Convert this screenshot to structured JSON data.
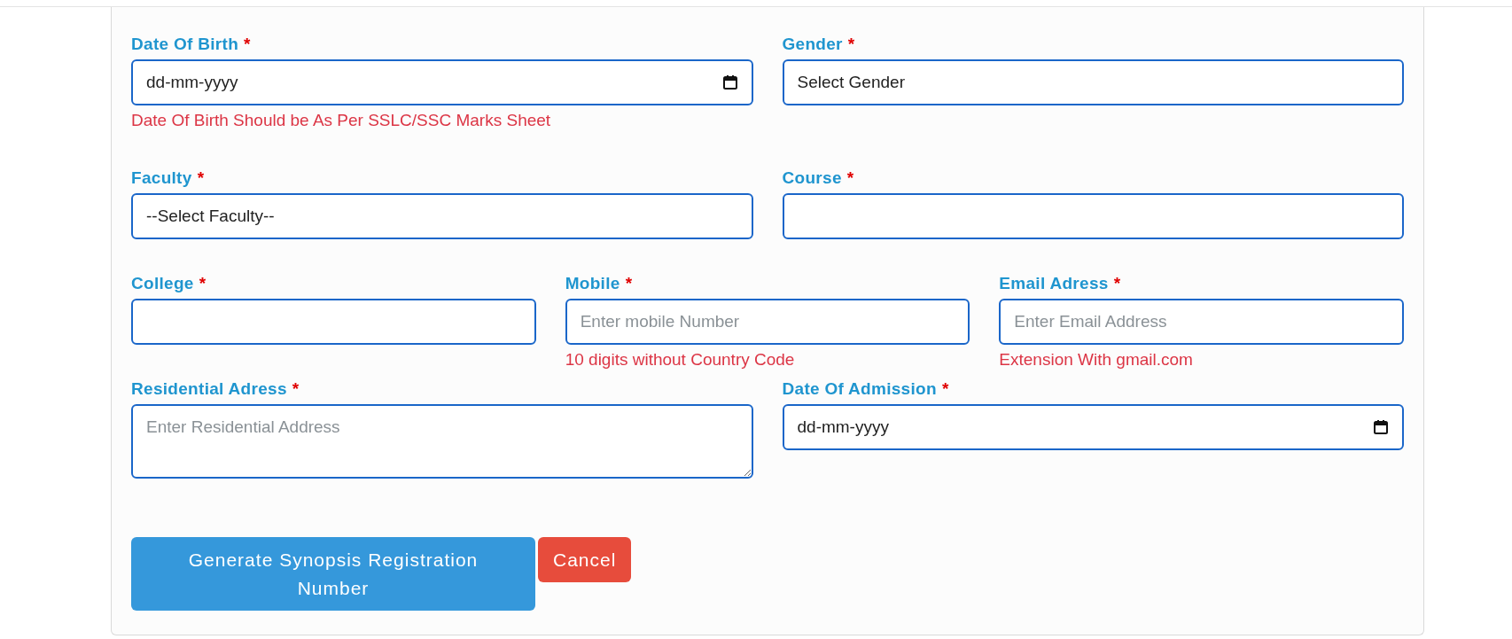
{
  "required_mark": "*",
  "rows": [
    {
      "fields": [
        {
          "label": "Date Of Birth",
          "required": true,
          "kind": "date",
          "value": "dd-mm-yyyy",
          "hint": "Date Of Birth Should be As Per SSLC/SSC Marks Sheet"
        },
        {
          "label": "Gender",
          "required": true,
          "kind": "select",
          "value": "Select Gender"
        }
      ]
    },
    {
      "fields": [
        {
          "label": "Faculty",
          "required": true,
          "kind": "select",
          "value": "--Select Faculty--"
        },
        {
          "label": "Course",
          "required": true,
          "kind": "select"
        }
      ]
    },
    {
      "fields": [
        {
          "label": "College",
          "required": true,
          "kind": "text"
        },
        {
          "label": "Mobile",
          "required": true,
          "kind": "text",
          "placeholder": "Enter mobile Number",
          "hint": "10 digits without Country Code"
        },
        {
          "label": "Email Adress",
          "required": true,
          "kind": "text",
          "placeholder": "Enter Email Address",
          "hint": "Extension With gmail.com"
        }
      ]
    },
    {
      "fields": [
        {
          "label": "Residential Adress",
          "required": true,
          "kind": "textarea",
          "placeholder": "Enter Residential Address"
        },
        {
          "label": "Date Of Admission",
          "required": true,
          "kind": "date",
          "value": "dd-mm-yyyy"
        }
      ]
    }
  ],
  "buttons": [
    {
      "label": "Generate Synopsis Registration Number",
      "kind": "primary"
    },
    {
      "label": "Cancel",
      "kind": "danger"
    }
  ]
}
